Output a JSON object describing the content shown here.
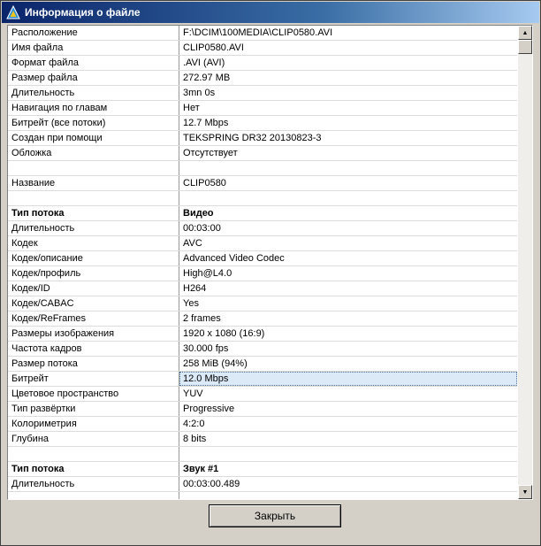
{
  "window": {
    "title": "Информация о файле"
  },
  "table": {
    "rows": [
      {
        "name": "Расположение",
        "value": "F:\\DCIM\\100MEDIA\\CLIP0580.AVI"
      },
      {
        "name": "Имя файла",
        "value": "CLIP0580.AVI"
      },
      {
        "name": "Формат файла",
        "value": ".AVI (AVI)"
      },
      {
        "name": "Размер файла",
        "value": "272.97 MB"
      },
      {
        "name": "Длительность",
        "value": "3mn 0s"
      },
      {
        "name": "Навигация по главам",
        "value": "Нет"
      },
      {
        "name": "Битрейт (все потоки)",
        "value": "12.7 Mbps"
      },
      {
        "name": "Создан при помощи",
        "value": "TEKSPRING DR32 20130823-3"
      },
      {
        "name": "Обложка",
        "value": "Отсутствует"
      },
      {
        "name": "",
        "value": ""
      },
      {
        "name": "Название",
        "value": "CLIP0580"
      },
      {
        "name": "",
        "value": ""
      },
      {
        "name": "Тип потока",
        "value": "Видео",
        "bold": true
      },
      {
        "name": "Длительность",
        "value": "00:03:00"
      },
      {
        "name": "Кодек",
        "value": "AVC"
      },
      {
        "name": "Кодек/описание",
        "value": "Advanced Video Codec"
      },
      {
        "name": "Кодек/профиль",
        "value": "High@L4.0"
      },
      {
        "name": "Кодек/ID",
        "value": "H264"
      },
      {
        "name": "Кодек/CABAC",
        "value": "Yes"
      },
      {
        "name": "Кодек/ReFrames",
        "value": "2 frames"
      },
      {
        "name": "Размеры изображения",
        "value": "1920 x 1080 (16:9)"
      },
      {
        "name": "Частота кадров",
        "value": "30.000 fps"
      },
      {
        "name": "Размер потока",
        "value": "258 MiB (94%)"
      },
      {
        "name": "Битрейт",
        "value": "12.0 Mbps",
        "selected": true
      },
      {
        "name": "Цветовое пространство",
        "value": "YUV"
      },
      {
        "name": "Тип развёртки",
        "value": "Progressive"
      },
      {
        "name": "Колориметрия",
        "value": "4:2:0"
      },
      {
        "name": "Глубина",
        "value": "8 bits"
      },
      {
        "name": "",
        "value": ""
      },
      {
        "name": "Тип потока",
        "value": "Звук #1",
        "bold": true
      },
      {
        "name": "Длительность",
        "value": "00:03:00.489"
      },
      {
        "name": "",
        "value": ""
      }
    ]
  },
  "buttons": {
    "close_label": "Закрыть"
  },
  "scrollbar": {
    "position": 0.0
  },
  "colors": {
    "title_start": "#0a246a",
    "title_end": "#a6caf0",
    "selection": "#dce9f7",
    "face": "#d4d0c8"
  }
}
